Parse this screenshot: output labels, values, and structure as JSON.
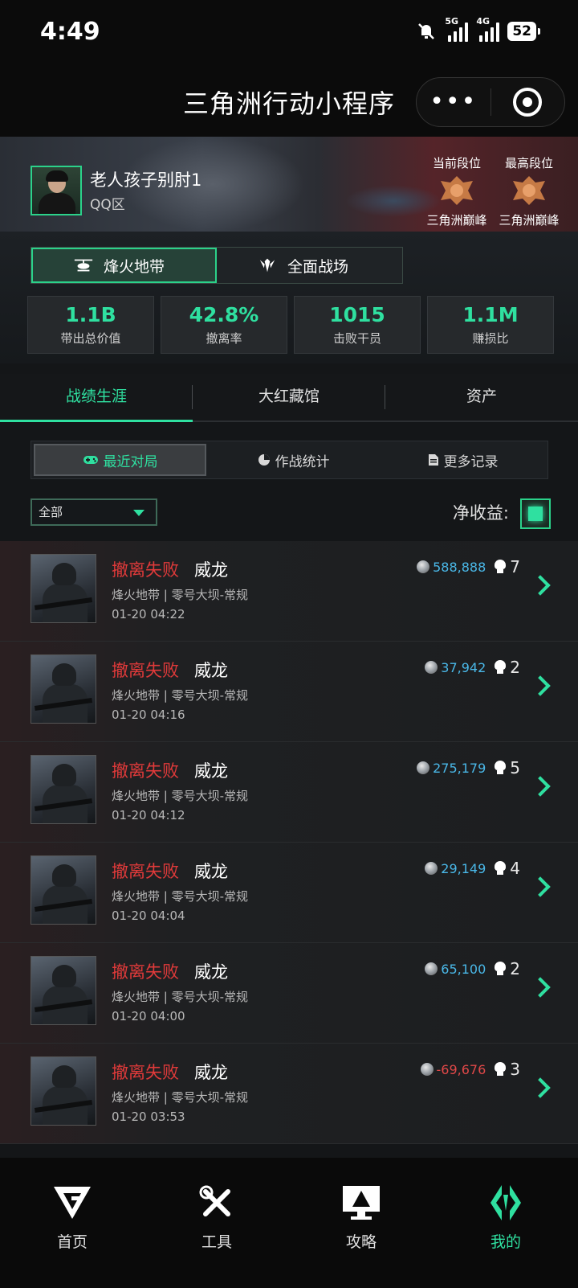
{
  "status_bar": {
    "time": "4:49",
    "net1": "5G",
    "net2": "4G",
    "battery": "52"
  },
  "titlebar": {
    "title": "三角洲行动小程序",
    "more_icon": "more-dots-icon",
    "target_icon": "target-icon"
  },
  "profile": {
    "username": "老人孩子别肘1",
    "server": "QQ区",
    "current_rank_label": "当前段位",
    "current_rank_name": "三角洲巅峰",
    "highest_rank_label": "最高段位",
    "highest_rank_name": "三角洲巅峰"
  },
  "modes": [
    {
      "label": "烽火地带",
      "icon": "helicopter-icon",
      "active": true
    },
    {
      "label": "全面战场",
      "icon": "wings-emblem-icon",
      "active": false
    }
  ],
  "stats": [
    {
      "value": "1.1B",
      "label": "带出总价值"
    },
    {
      "value": "42.8%",
      "label": "撤离率"
    },
    {
      "value": "1015",
      "label": "击败干员"
    },
    {
      "value": "1.1M",
      "label": "赚损比"
    }
  ],
  "section_tabs": [
    {
      "label": "战绩生涯",
      "active": true
    },
    {
      "label": "大红藏馆",
      "active": false
    },
    {
      "label": "资产",
      "active": false
    }
  ],
  "sub_tabs": [
    {
      "label": "最近对局",
      "icon": "gamepad-icon",
      "active": true
    },
    {
      "label": "作战统计",
      "icon": "pie-chart-icon",
      "active": false
    },
    {
      "label": "更多记录",
      "icon": "document-icon",
      "active": false
    }
  ],
  "filter": {
    "selected": "全部",
    "net_label": "净收益:",
    "net_checked": true
  },
  "matches": [
    {
      "status": "撤离失败",
      "operator": "威龙",
      "mode": "烽火地带 | 零号大坝-常规",
      "time": "01-20 04:22",
      "amount": "588,888",
      "negative": false,
      "kills": "7"
    },
    {
      "status": "撤离失败",
      "operator": "威龙",
      "mode": "烽火地带 | 零号大坝-常规",
      "time": "01-20 04:16",
      "amount": "37,942",
      "negative": false,
      "kills": "2"
    },
    {
      "status": "撤离失败",
      "operator": "威龙",
      "mode": "烽火地带 | 零号大坝-常规",
      "time": "01-20 04:12",
      "amount": "275,179",
      "negative": false,
      "kills": "5"
    },
    {
      "status": "撤离失败",
      "operator": "威龙",
      "mode": "烽火地带 | 零号大坝-常规",
      "time": "01-20 04:04",
      "amount": "29,149",
      "negative": false,
      "kills": "4"
    },
    {
      "status": "撤离失败",
      "operator": "威龙",
      "mode": "烽火地带 | 零号大坝-常规",
      "time": "01-20 04:00",
      "amount": "65,100",
      "negative": false,
      "kills": "2"
    },
    {
      "status": "撤离失败",
      "operator": "威龙",
      "mode": "烽火地带 | 零号大坝-常规",
      "time": "01-20 03:53",
      "amount": "-69,676",
      "negative": true,
      "kills": "3"
    }
  ],
  "bottom_nav": [
    {
      "label": "首页",
      "icon": "home-logo-icon",
      "active": false
    },
    {
      "label": "工具",
      "icon": "tools-icon",
      "active": false
    },
    {
      "label": "攻略",
      "icon": "guide-monitor-icon",
      "active": false
    },
    {
      "label": "我的",
      "icon": "profile-logo-icon",
      "active": true
    }
  ],
  "colors": {
    "accent": "#2fe0a0",
    "fail": "#e03a3a",
    "amount_positive": "#4ab8e8",
    "amount_negative": "#e04848"
  }
}
